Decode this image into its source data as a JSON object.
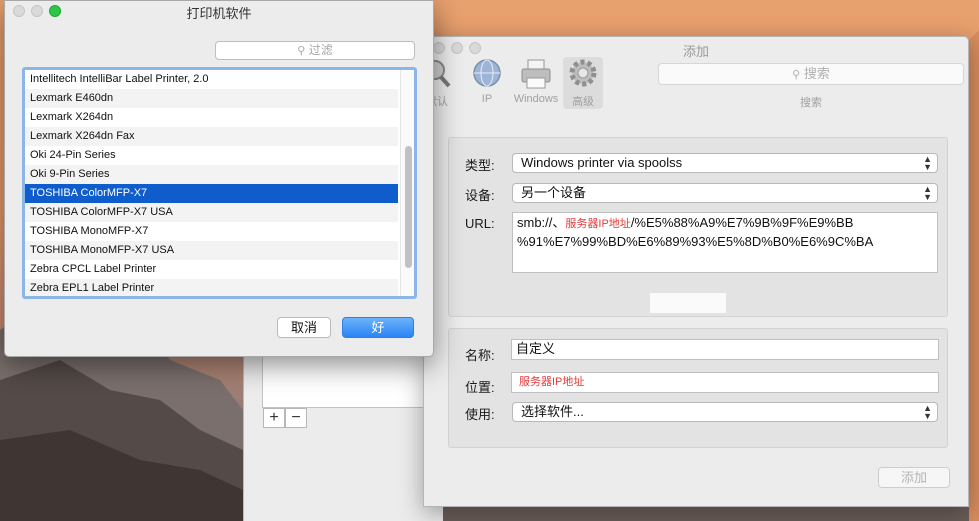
{
  "software_dialog": {
    "title": "打印机软件",
    "filter_placeholder": "过滤",
    "items": [
      "Intellitech IntelliBar Label Printer, 2.0",
      "Lexmark E460dn",
      "Lexmark X264dn",
      "Lexmark X264dn Fax",
      "Oki 24-Pin Series",
      "Oki 9-Pin Series",
      "TOSHIBA ColorMFP-X7",
      "TOSHIBA ColorMFP-X7 USA",
      "TOSHIBA MonoMFP-X7",
      "TOSHIBA MonoMFP-X7 USA",
      "Zebra CPCL Label Printer",
      "Zebra EPL1 Label Printer"
    ],
    "selected_item": "TOSHIBA ColorMFP-X7",
    "cancel_label": "取消",
    "ok_label": "好"
  },
  "add_window": {
    "title": "添加",
    "toolbar": {
      "default_label": "默认",
      "ip_label": "IP",
      "windows_label": "Windows",
      "advanced_label": "高级"
    },
    "search_placeholder": "搜索",
    "search_label": "搜索",
    "type_label": "类型:",
    "type_value": "Windows printer via spoolss",
    "device_label": "设备:",
    "device_value": "另一个设备",
    "url_label": "URL:",
    "url_prefix": "smb://、",
    "url_server": "服务器IP地址",
    "url_rest_1": "/%E5%88%A9%E7%9B%9F%E9%BB",
    "url_rest_2": "%91%E7%99%BD%E6%89%93%E5%8D%B0%E6%9C%BA",
    "name_label": "名称:",
    "name_value": "自定义",
    "location_label": "位置:",
    "location_value": "服务器IP地址",
    "use_label": "使用:",
    "use_value": "选择软件...",
    "add_button": "添加"
  },
  "back_window": {
    "add_symbol": "+",
    "remove_symbol": "−"
  },
  "colors": {
    "selection": "#0f5ccc",
    "ok_button": "#2a84f5",
    "annotation_red": "#e23b3b"
  }
}
